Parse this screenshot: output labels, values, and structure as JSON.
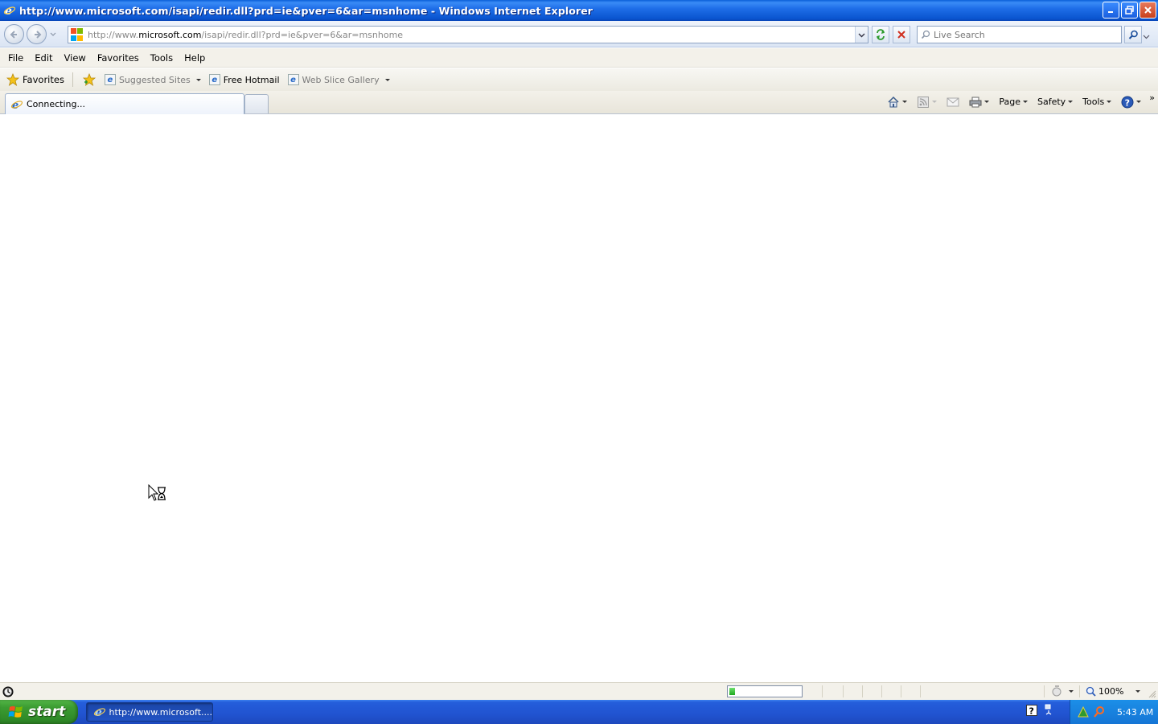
{
  "window": {
    "title": "http://www.microsoft.com/isapi/redir.dll?prd=ie&pver=6&ar=msnhome - Windows Internet Explorer"
  },
  "address_bar": {
    "url_prefix": "http://www.",
    "url_domain": "microsoft.com",
    "url_suffix": "/isapi/redir.dll?prd=ie&pver=6&ar=msnhome",
    "search_placeholder": "Live Search"
  },
  "menu": {
    "items": [
      "File",
      "Edit",
      "View",
      "Favorites",
      "Tools",
      "Help"
    ]
  },
  "favorites_bar": {
    "favorites_label": "Favorites",
    "links": [
      {
        "label": "Suggested Sites",
        "dimmed": true,
        "has_dropdown": true
      },
      {
        "label": "Free Hotmail",
        "dimmed": false,
        "has_dropdown": false
      },
      {
        "label": "Web Slice Gallery",
        "dimmed": true,
        "has_dropdown": true
      }
    ]
  },
  "tabs": {
    "active_label": "Connecting..."
  },
  "command_bar": {
    "page_label": "Page",
    "safety_label": "Safety",
    "tools_label": "Tools",
    "overflow": "»"
  },
  "status_bar": {
    "status_text": "",
    "zoom": "100%",
    "progress_fraction": 0.08
  },
  "taskbar": {
    "start_label": "start",
    "task_label": "http://www.microsoft....",
    "clock": "5:43 AM"
  },
  "colors": {
    "titlebar": "#1f6ee8",
    "taskbar": "#245edb",
    "start_green": "#3c9c32"
  }
}
